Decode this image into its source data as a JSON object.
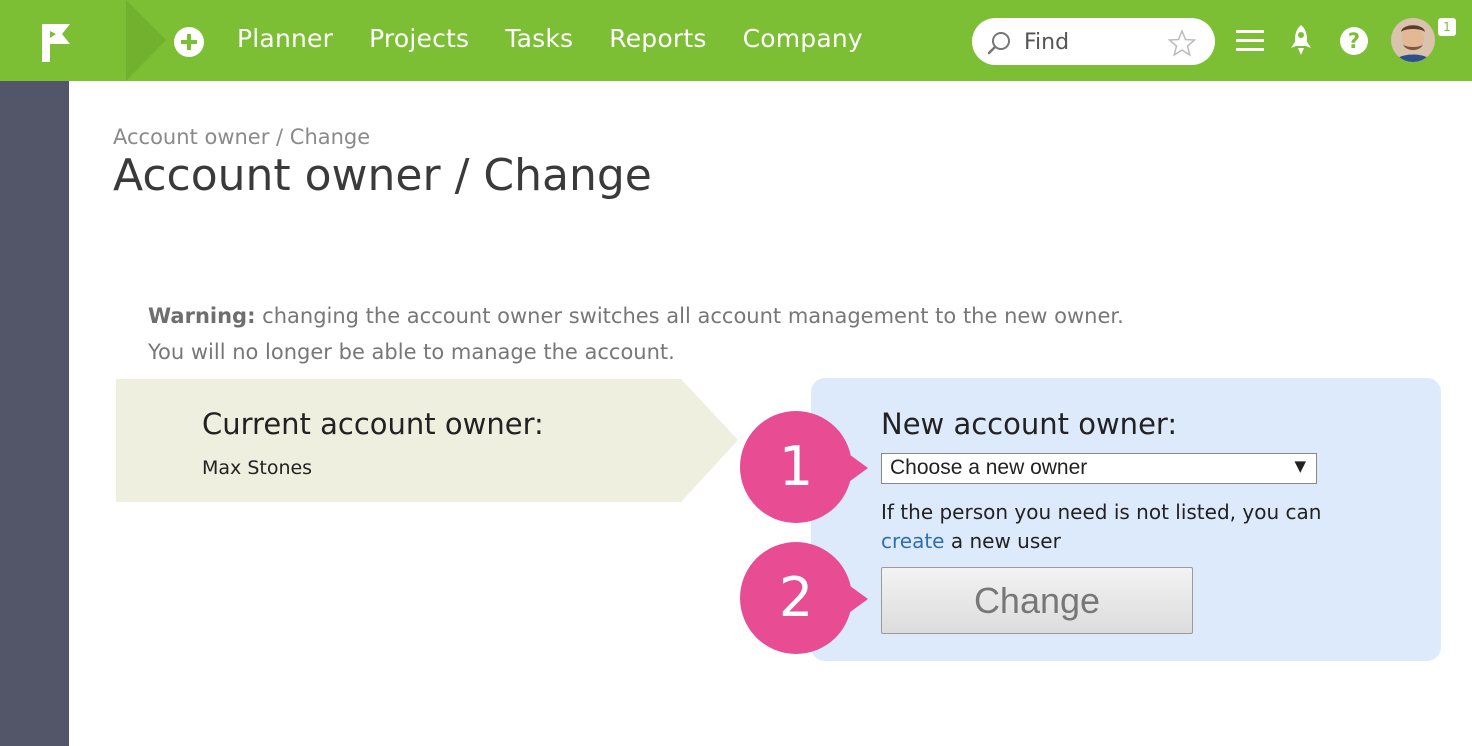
{
  "header": {
    "nav": [
      {
        "label": "Planner"
      },
      {
        "label": "Projects"
      },
      {
        "label": "Tasks"
      },
      {
        "label": "Reports"
      },
      {
        "label": "Company"
      }
    ],
    "search_placeholder": "Find",
    "notification_count": "1",
    "help_glyph": "?",
    "icons": {
      "logo": "flag-logo-icon",
      "add": "plus-circle-icon",
      "search": "search-icon",
      "favorite": "star-icon",
      "menu": "hamburger-menu-icon",
      "whats_new": "rocket-icon",
      "help": "help-icon"
    },
    "brand_color": "#7cbf35"
  },
  "page": {
    "breadcrumb": "Account owner / Change",
    "title": "Account owner / Change"
  },
  "warning": {
    "label": "Warning:",
    "line1": " changing the account owner switches all account management to the new owner.",
    "line2": "You will no longer be able to manage the account."
  },
  "current_owner": {
    "label": "Current account owner:",
    "name": "Max Stones"
  },
  "new_owner": {
    "label": "New account owner:",
    "select_value": "Choose a new owner",
    "hint_text": "If the person you need is not listed, you can",
    "hint_link": "create",
    "hint_suffix": " a new user",
    "button": "Change"
  },
  "callouts": [
    "1",
    "2"
  ],
  "callout_color": "#e84c93"
}
